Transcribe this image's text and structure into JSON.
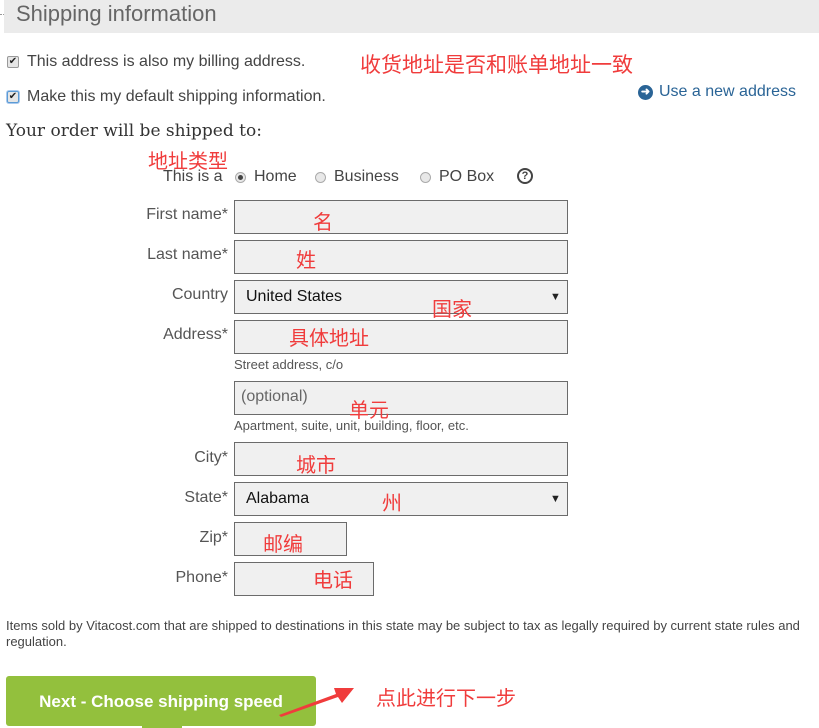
{
  "header": {
    "title": "Shipping information"
  },
  "options": {
    "billing_same": {
      "label": "This address is also my billing address.",
      "checked": true
    },
    "default_shipping": {
      "label": "Make this my default shipping information.",
      "checked": true
    }
  },
  "use_new_address": {
    "label": "Use a new address",
    "icon": "arrow-right-circle-icon"
  },
  "shipped_to_heading": "Your order will be shipped to:",
  "address_type": {
    "prefix": "This is a",
    "options": [
      {
        "label": "Home",
        "selected": true
      },
      {
        "label": "Business",
        "selected": false
      },
      {
        "label": "PO Box",
        "selected": false
      }
    ],
    "help_icon": "?"
  },
  "form": {
    "first_name": {
      "label": "First name*",
      "value": ""
    },
    "last_name": {
      "label": "Last name*",
      "value": ""
    },
    "country": {
      "label": "Country",
      "selected": "United States"
    },
    "address": {
      "label": "Address*",
      "value": "",
      "hint": "Street address, c/o"
    },
    "address2": {
      "placeholder": "(optional)",
      "hint": "Apartment, suite, unit, building, floor, etc."
    },
    "city": {
      "label": "City*",
      "value": ""
    },
    "state": {
      "label": "State*",
      "selected": "Alabama"
    },
    "zip": {
      "label": "Zip*",
      "value": ""
    },
    "phone": {
      "label": "Phone*",
      "value": ""
    }
  },
  "disclaimer": "Items sold by Vitacost.com that are shipped to destinations in this state may be subject to tax as legally required by current state rules and regulation.",
  "next_button": {
    "label": "Next - Choose shipping speed"
  },
  "annotations": {
    "billing": "收货地址是否和账单地址一致",
    "address_type": "地址类型",
    "first_name": "名",
    "last_name": "姓",
    "country": "国家",
    "address": "具体地址",
    "address2": "单元",
    "city": "城市",
    "state": "州",
    "zip": "邮编",
    "phone": "电话",
    "next": "点此进行下一步"
  },
  "colors": {
    "annotation": "#f03c3c",
    "button": "#93c03d",
    "link": "#2a6496",
    "input_bg": "#f0f0f0"
  }
}
